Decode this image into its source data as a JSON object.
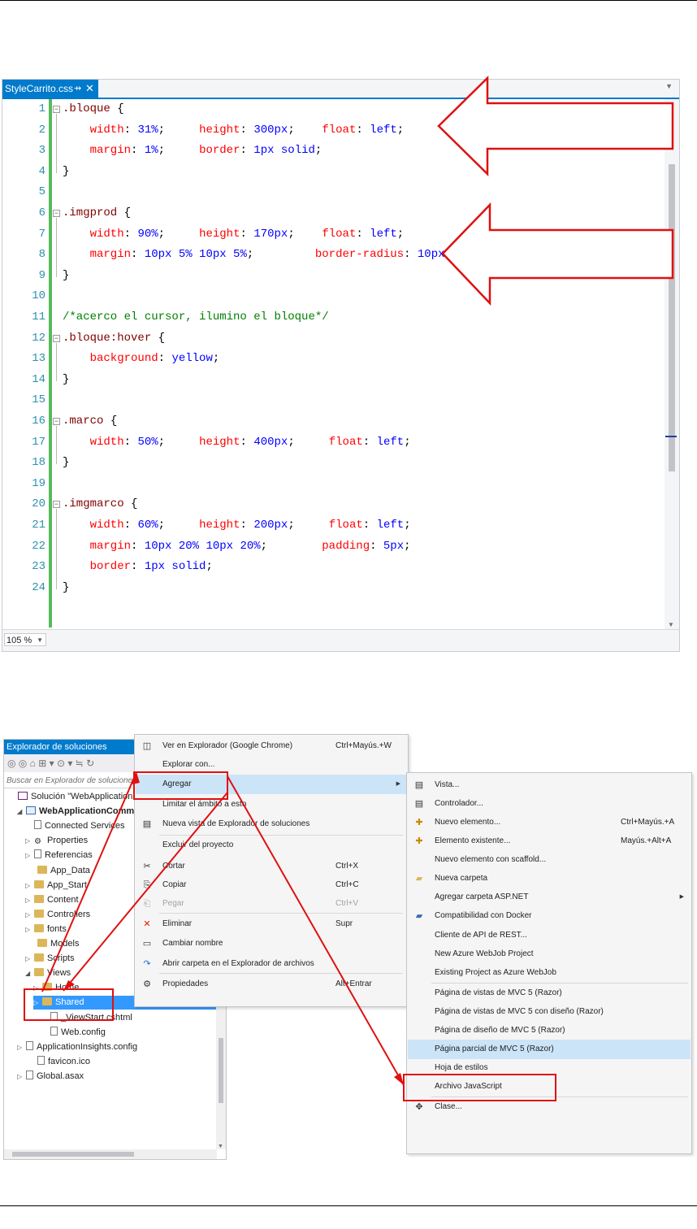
{
  "editor": {
    "tab_title": "StyleCarrito.css",
    "tab_pin": "⇸",
    "tab_close": "✕",
    "zoom": "105 %",
    "lines": [
      {
        "n": "1",
        "fold": "⊟",
        "parts": [
          {
            "c": "sel",
            "t": ".bloque "
          },
          {
            "c": "brace",
            "t": "{"
          }
        ]
      },
      {
        "n": "2",
        "parts": [
          {
            "c": "prop",
            "t": "    width"
          },
          {
            "c": "brace",
            "t": ": "
          },
          {
            "c": "val",
            "t": "31%"
          },
          {
            "c": "brace",
            "t": ";     "
          },
          {
            "c": "prop",
            "t": "height"
          },
          {
            "c": "brace",
            "t": ": "
          },
          {
            "c": "val",
            "t": "300px"
          },
          {
            "c": "brace",
            "t": ";    "
          },
          {
            "c": "prop",
            "t": "float"
          },
          {
            "c": "brace",
            "t": ": "
          },
          {
            "c": "val",
            "t": "left"
          },
          {
            "c": "brace",
            "t": ";"
          }
        ]
      },
      {
        "n": "3",
        "parts": [
          {
            "c": "prop",
            "t": "    margin"
          },
          {
            "c": "brace",
            "t": ": "
          },
          {
            "c": "val",
            "t": "1%"
          },
          {
            "c": "brace",
            "t": ";     "
          },
          {
            "c": "prop",
            "t": "border"
          },
          {
            "c": "brace",
            "t": ": "
          },
          {
            "c": "val",
            "t": "1px solid"
          },
          {
            "c": "brace",
            "t": ";"
          }
        ]
      },
      {
        "n": "4",
        "parts": [
          {
            "c": "brace",
            "t": "}"
          }
        ]
      },
      {
        "n": "5",
        "parts": []
      },
      {
        "n": "6",
        "fold": "⊟",
        "parts": [
          {
            "c": "sel",
            "t": ".imgprod "
          },
          {
            "c": "brace",
            "t": "{"
          }
        ]
      },
      {
        "n": "7",
        "parts": [
          {
            "c": "prop",
            "t": "    width"
          },
          {
            "c": "brace",
            "t": ": "
          },
          {
            "c": "val",
            "t": "90%"
          },
          {
            "c": "brace",
            "t": ";     "
          },
          {
            "c": "prop",
            "t": "height"
          },
          {
            "c": "brace",
            "t": ": "
          },
          {
            "c": "val",
            "t": "170px"
          },
          {
            "c": "brace",
            "t": ";    "
          },
          {
            "c": "prop",
            "t": "float"
          },
          {
            "c": "brace",
            "t": ": "
          },
          {
            "c": "val",
            "t": "left"
          },
          {
            "c": "brace",
            "t": ";"
          }
        ]
      },
      {
        "n": "8",
        "parts": [
          {
            "c": "prop",
            "t": "    margin"
          },
          {
            "c": "brace",
            "t": ": "
          },
          {
            "c": "val",
            "t": "10px 5% 10px 5%"
          },
          {
            "c": "brace",
            "t": ";         "
          },
          {
            "c": "prop",
            "t": "border-radius"
          },
          {
            "c": "brace",
            "t": ": "
          },
          {
            "c": "val",
            "t": "10px"
          },
          {
            "c": "brace",
            "t": ";"
          }
        ]
      },
      {
        "n": "9",
        "parts": [
          {
            "c": "brace",
            "t": "}"
          }
        ]
      },
      {
        "n": "10",
        "parts": []
      },
      {
        "n": "11",
        "parts": [
          {
            "c": "cmt",
            "t": "/*acerco el cursor, ilumino el bloque*/"
          }
        ]
      },
      {
        "n": "12",
        "fold": "⊟",
        "parts": [
          {
            "c": "sel",
            "t": ".bloque:hover "
          },
          {
            "c": "brace",
            "t": "{"
          }
        ]
      },
      {
        "n": "13",
        "parts": [
          {
            "c": "prop",
            "t": "    background"
          },
          {
            "c": "brace",
            "t": ": "
          },
          {
            "c": "val",
            "t": "yellow"
          },
          {
            "c": "brace",
            "t": ";"
          }
        ]
      },
      {
        "n": "14",
        "parts": [
          {
            "c": "brace",
            "t": "}"
          }
        ]
      },
      {
        "n": "15",
        "parts": []
      },
      {
        "n": "16",
        "fold": "⊟",
        "parts": [
          {
            "c": "sel",
            "t": ".marco "
          },
          {
            "c": "brace",
            "t": "{"
          }
        ]
      },
      {
        "n": "17",
        "parts": [
          {
            "c": "prop",
            "t": "    width"
          },
          {
            "c": "brace",
            "t": ": "
          },
          {
            "c": "val",
            "t": "50%"
          },
          {
            "c": "brace",
            "t": ";     "
          },
          {
            "c": "prop",
            "t": "height"
          },
          {
            "c": "brace",
            "t": ": "
          },
          {
            "c": "val",
            "t": "400px"
          },
          {
            "c": "brace",
            "t": ";     "
          },
          {
            "c": "prop",
            "t": "float"
          },
          {
            "c": "brace",
            "t": ": "
          },
          {
            "c": "val",
            "t": "left"
          },
          {
            "c": "brace",
            "t": ";"
          }
        ]
      },
      {
        "n": "18",
        "parts": [
          {
            "c": "brace",
            "t": "}"
          }
        ]
      },
      {
        "n": "19",
        "parts": []
      },
      {
        "n": "20",
        "fold": "⊟",
        "parts": [
          {
            "c": "sel",
            "t": ".imgmarco "
          },
          {
            "c": "brace",
            "t": "{"
          }
        ]
      },
      {
        "n": "21",
        "parts": [
          {
            "c": "prop",
            "t": "    width"
          },
          {
            "c": "brace",
            "t": ": "
          },
          {
            "c": "val",
            "t": "60%"
          },
          {
            "c": "brace",
            "t": ";     "
          },
          {
            "c": "prop",
            "t": "height"
          },
          {
            "c": "brace",
            "t": ": "
          },
          {
            "c": "val",
            "t": "200px"
          },
          {
            "c": "brace",
            "t": ";     "
          },
          {
            "c": "prop",
            "t": "float"
          },
          {
            "c": "brace",
            "t": ": "
          },
          {
            "c": "val",
            "t": "left"
          },
          {
            "c": "brace",
            "t": ";"
          }
        ]
      },
      {
        "n": "22",
        "parts": [
          {
            "c": "prop",
            "t": "    margin"
          },
          {
            "c": "brace",
            "t": ": "
          },
          {
            "c": "val",
            "t": "10px 20% 10px 20%"
          },
          {
            "c": "brace",
            "t": ";        "
          },
          {
            "c": "prop",
            "t": "padding"
          },
          {
            "c": "brace",
            "t": ": "
          },
          {
            "c": "val",
            "t": "5px"
          },
          {
            "c": "brace",
            "t": ";"
          }
        ]
      },
      {
        "n": "23",
        "parts": [
          {
            "c": "prop",
            "t": "    border"
          },
          {
            "c": "brace",
            "t": ": "
          },
          {
            "c": "val",
            "t": "1px solid"
          },
          {
            "c": "brace",
            "t": ";"
          }
        ]
      },
      {
        "n": "24",
        "parts": [
          {
            "c": "brace",
            "t": "}"
          }
        ]
      }
    ]
  },
  "solution_explorer": {
    "title": "Explorador de soluciones",
    "title_controls": "▾ ◻ ✕",
    "toolbar": "◎ ◎ ⌂ ⊞ ▾  ⊙ ▾ ≒ ↻",
    "search_placeholder": "Buscar en Explorador de soluciones",
    "tree": [
      {
        "label": "Solución \"WebApplicationCo",
        "icon": "sol",
        "exp": ""
      },
      {
        "label": "WebApplicationComm",
        "icon": "proj",
        "exp": "◢",
        "bold": true
      },
      {
        "label": "Connected Services",
        "icon": "file",
        "exp": ""
      },
      {
        "label": "Properties",
        "icon": "wrench",
        "exp": "▷"
      },
      {
        "label": "Referencias",
        "icon": "file",
        "exp": "▷"
      },
      {
        "label": "App_Data",
        "icon": "folder",
        "exp": ""
      },
      {
        "label": "App_Start",
        "icon": "folder",
        "exp": "▷"
      },
      {
        "label": "Content",
        "icon": "folder",
        "exp": "▷"
      },
      {
        "label": "Controllers",
        "icon": "folder",
        "exp": "▷"
      },
      {
        "label": "fonts",
        "icon": "folder",
        "exp": "▷"
      },
      {
        "label": "Models",
        "icon": "folder",
        "exp": ""
      },
      {
        "label": "Scripts",
        "icon": "folder",
        "exp": "▷"
      },
      {
        "label": "Views",
        "icon": "folder",
        "exp": "◢"
      },
      {
        "label": "Home",
        "icon": "folder",
        "exp": "▷"
      },
      {
        "label": "Shared",
        "icon": "folder",
        "exp": "▷",
        "selected": true
      },
      {
        "label": "_ViewStart.cshtml",
        "icon": "file",
        "exp": ""
      },
      {
        "label": "Web.config",
        "icon": "file",
        "exp": ""
      },
      {
        "label": "ApplicationInsights.config",
        "icon": "file",
        "exp": "▷"
      },
      {
        "label": "favicon.ico",
        "icon": "file",
        "exp": ""
      },
      {
        "label": "Global.asax",
        "icon": "file",
        "exp": "▷"
      }
    ]
  },
  "context_menu": {
    "items": [
      {
        "icon": "◫",
        "label": "Ver en Explorador (Google Chrome)",
        "shortcut": "Ctrl+Mayús.+W"
      },
      {
        "label": "Explorar con..."
      },
      {
        "label": "Agregar",
        "submenu": true,
        "highlighted": true
      },
      {
        "label": "Limitar el ámbito a esto"
      },
      {
        "icon": "▤",
        "label": "Nueva vista de Explorador de soluciones"
      },
      {
        "label": "Excluir del proyecto"
      },
      {
        "icon": "✂",
        "label": "Cortar",
        "shortcut": "Ctrl+X"
      },
      {
        "icon": "⎘",
        "label": "Copiar",
        "shortcut": "Ctrl+C"
      },
      {
        "icon": "⎗",
        "label": "Pegar",
        "shortcut": "Ctrl+V",
        "disabled": true
      },
      {
        "icon": "✕",
        "label": "Eliminar",
        "shortcut": "Supr",
        "icon_color": "#e51400"
      },
      {
        "icon": "▭",
        "label": "Cambiar nombre"
      },
      {
        "icon": "↷",
        "label": "Abrir carpeta en el Explorador de archivos",
        "icon_color": "#1e6fd9"
      },
      {
        "icon": "⚙",
        "label": "Propiedades",
        "shortcut": "Alt+Entrar"
      }
    ]
  },
  "submenu": {
    "items": [
      {
        "icon": "▤",
        "label": "Vista..."
      },
      {
        "icon": "▤",
        "label": "Controlador..."
      },
      {
        "icon": "✚",
        "label": "Nuevo elemento...",
        "shortcut": "Ctrl+Mayús.+A",
        "icon_color": "#c88a00"
      },
      {
        "icon": "✚",
        "label": "Elemento existente...",
        "shortcut": "Mayús.+Alt+A",
        "icon_color": "#c88a00"
      },
      {
        "label": "Nuevo elemento con scaffold..."
      },
      {
        "icon": "▰",
        "label": "Nueva carpeta",
        "icon_color": "#dcb65b"
      },
      {
        "label": "Agregar carpeta ASP.NET",
        "submenu": true
      },
      {
        "icon": "▰",
        "label": "Compatibilidad con Docker",
        "icon_color": "#3a6fb0"
      },
      {
        "label": "Cliente de API de REST..."
      },
      {
        "label": "New Azure WebJob Project"
      },
      {
        "label": "Existing Project as Azure WebJob"
      },
      {
        "label": "Página de vistas de MVC 5 (Razor)"
      },
      {
        "label": "Página de vistas de MVC 5 con diseño (Razor)"
      },
      {
        "label": "Página de diseño de MVC 5 (Razor)"
      },
      {
        "label": "Página parcial de MVC 5 (Razor)",
        "highlighted": true
      },
      {
        "label": "Hoja de estilos"
      },
      {
        "label": "Archivo JavaScript"
      },
      {
        "icon": "✥",
        "label": "Clase..."
      }
    ]
  },
  "colors": {
    "accent": "#007acc",
    "annotation_red": "#e01010",
    "menu_highlight": "#cce4f7",
    "tree_selection": "#3399ff",
    "css_selector": "#800000",
    "css_property": "#ff0000",
    "css_value": "#0000ff",
    "css_comment": "#008000"
  }
}
